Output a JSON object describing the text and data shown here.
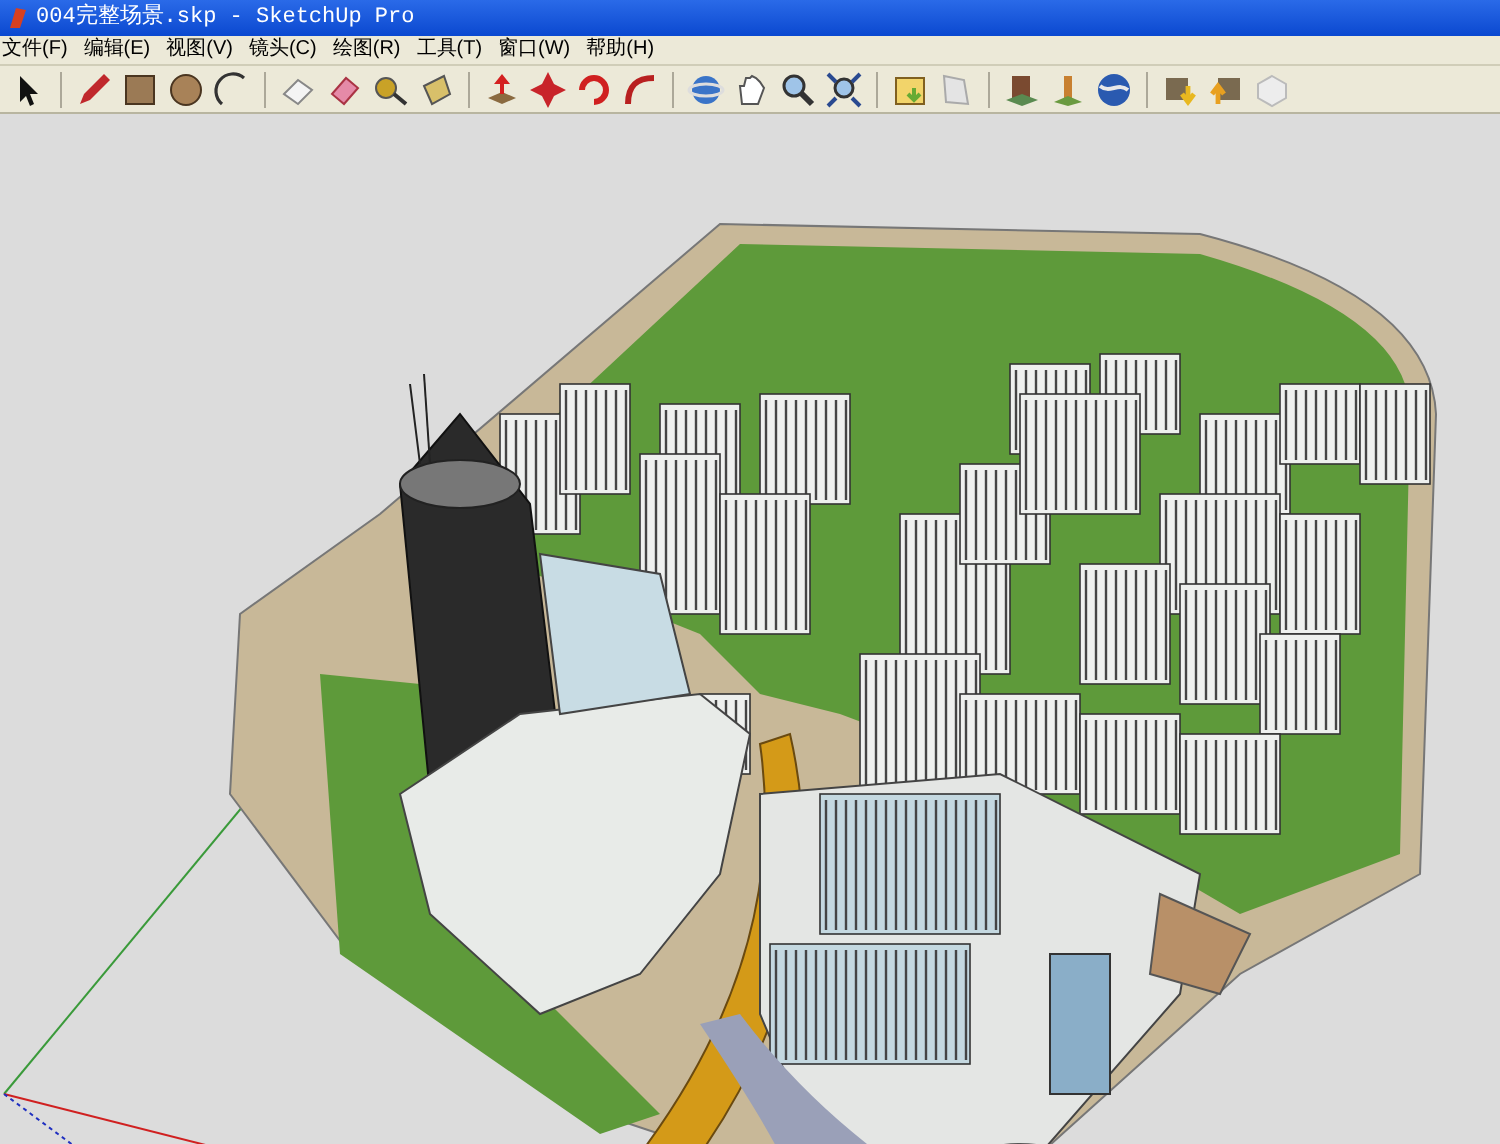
{
  "window": {
    "title": "004完整场景.skp - SketchUp Pro"
  },
  "menu": [
    "文件(F)",
    "编辑(E)",
    "视图(V)",
    "镜头(C)",
    "绘图(R)",
    "工具(T)",
    "窗口(W)",
    "帮助(H)"
  ]
}
